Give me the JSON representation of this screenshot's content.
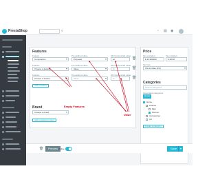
{
  "header": {
    "logo_text": "PrestaShop",
    "version": "1.7",
    "search_placeholder": "Search"
  },
  "features": {
    "title": "Features",
    "col_feature": "Feature",
    "col_predefined": "Pre-defined value",
    "col_custom": "OR Customized value",
    "rows": [
      {
        "feature": "Composition",
        "predefined": "Polyester",
        "custom": "en"
      },
      {
        "feature": "Choose a feature",
        "predefined": "Value",
        "custom": "en"
      },
      {
        "feature": "Choose a feature",
        "predefined": "Value",
        "custom": "en"
      }
    ],
    "add_button": "Add a feature"
  },
  "brand": {
    "title": "Brand",
    "select_value": "Choose a brand",
    "add_button": "Add a related product"
  },
  "price": {
    "title": "Price",
    "tax_excl_label": "Tax excluded",
    "tax_incl_label": "Tax included",
    "tax_excl_value": "€ 23.900000",
    "tax_incl_value": "€ 28.68",
    "tax_rule_label": "Tax rule",
    "tax_rule_value": "US-AL Rate (4%)"
  },
  "categories": {
    "title": "Categories",
    "search_placeholder": "Search categories",
    "associated_label": "Associated categories",
    "tag": "Home",
    "tree": [
      {
        "label": "Home",
        "checked": true
      },
      {
        "label": "Clothes",
        "checked": false
      },
      {
        "label": "Men",
        "checked": false
      },
      {
        "label": "Women",
        "checked": true
      },
      {
        "label": "Accessories",
        "checked": false
      },
      {
        "label": "Art",
        "checked": false
      }
    ],
    "create_button": "Create a category"
  },
  "bottom": {
    "preview": "Preview",
    "online": "Online",
    "save": "Save"
  },
  "annotations": {
    "empty_features": "Empty Features",
    "value": "Value"
  },
  "colors": {
    "accent": "#25b9d7",
    "sidebar": "#363a41",
    "annotation": "#d0021b"
  }
}
